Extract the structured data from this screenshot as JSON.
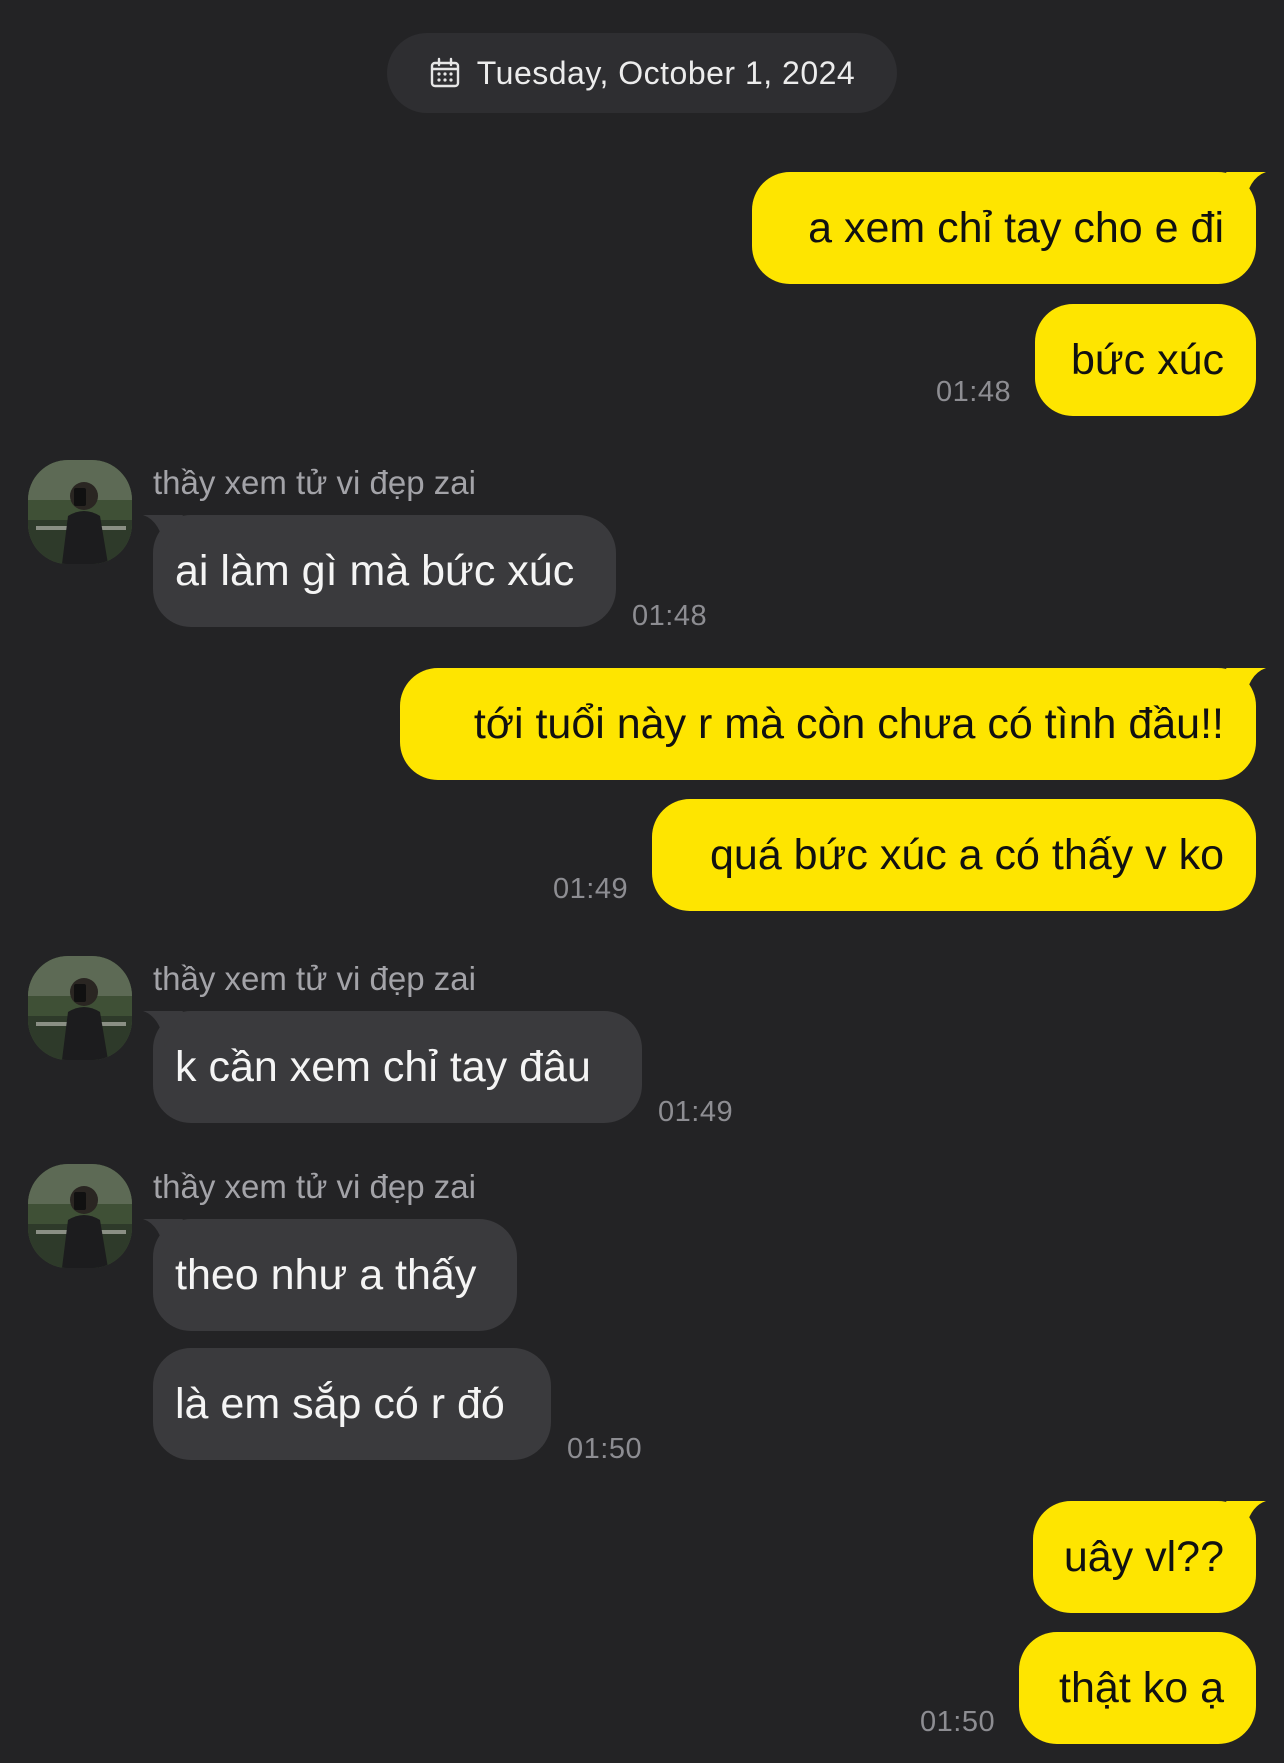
{
  "date_divider": {
    "icon": "calendar-icon",
    "label": "Tuesday, October 1, 2024"
  },
  "contact": {
    "name": "thầy xem tử vi đẹp zai",
    "avatar_icon": "profile-photo"
  },
  "colors": {
    "background": "#232325",
    "outgoing_bubble": "#fee500",
    "incoming_bubble": "#3a3a3d",
    "timestamp": "#8d8d92"
  },
  "messages": [
    {
      "direction": "outgoing",
      "text": "a xem chỉ tay cho e đi"
    },
    {
      "direction": "outgoing",
      "text": "bức xúc",
      "time": "01:48"
    },
    {
      "direction": "incoming",
      "sender": "thầy xem tử vi đẹp zai",
      "text": "ai làm gì mà bức xúc",
      "time": "01:48"
    },
    {
      "direction": "outgoing",
      "text": "tới tuổi này r mà còn chưa có tình đầu!!"
    },
    {
      "direction": "outgoing",
      "text": "quá bức xúc a có thấy v ko",
      "time": "01:49"
    },
    {
      "direction": "incoming",
      "sender": "thầy xem tử vi đẹp zai",
      "text": "k cần xem chỉ tay đâu",
      "time": "01:49"
    },
    {
      "direction": "incoming",
      "sender": "thầy xem tử vi đẹp zai",
      "text": "theo như a thấy"
    },
    {
      "direction": "incoming",
      "text": "là em sắp có r đó",
      "time": "01:50"
    },
    {
      "direction": "outgoing",
      "text": "uây vl??"
    },
    {
      "direction": "outgoing",
      "text": "thật ko ạ",
      "time": "01:50"
    }
  ]
}
